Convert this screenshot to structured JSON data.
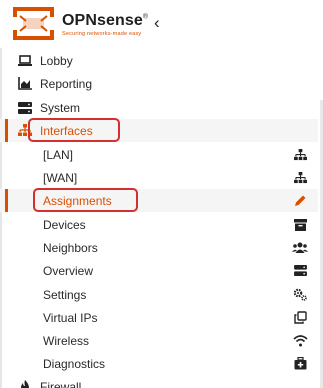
{
  "brand": {
    "name": "OPNsense",
    "tm": "®",
    "tagline": "Securing networks-made easy"
  },
  "header": {
    "collapse_glyph": "‹"
  },
  "menu": {
    "lobby": {
      "label": "Lobby",
      "icon": "laptop-icon"
    },
    "reporting": {
      "label": "Reporting",
      "icon": "area-chart-icon"
    },
    "system": {
      "label": "System",
      "icon": "server-icon"
    },
    "interfaces": {
      "label": "Interfaces",
      "icon": "sitemap-icon"
    },
    "firewall": {
      "label": "Firewall",
      "icon": "fire-icon"
    }
  },
  "interfaces_sub": [
    {
      "label": "[LAN]",
      "icon": "sitemap-icon"
    },
    {
      "label": "[WAN]",
      "icon": "sitemap-icon"
    },
    {
      "label": "Assignments",
      "icon": "pencil-icon"
    },
    {
      "label": "Devices",
      "icon": "archive-icon"
    },
    {
      "label": "Neighbors",
      "icon": "users-icon"
    },
    {
      "label": "Overview",
      "icon": "server-icon"
    },
    {
      "label": "Settings",
      "icon": "cogs-icon"
    },
    {
      "label": "Virtual IPs",
      "icon": "clone-icon"
    },
    {
      "label": "Wireless",
      "icon": "wifi-icon"
    },
    {
      "label": "Diagnostics",
      "icon": "medkit-icon"
    }
  ],
  "colors": {
    "accent": "#d94f00",
    "highlight": "#d32f2f",
    "text": "#2a2a2a"
  }
}
